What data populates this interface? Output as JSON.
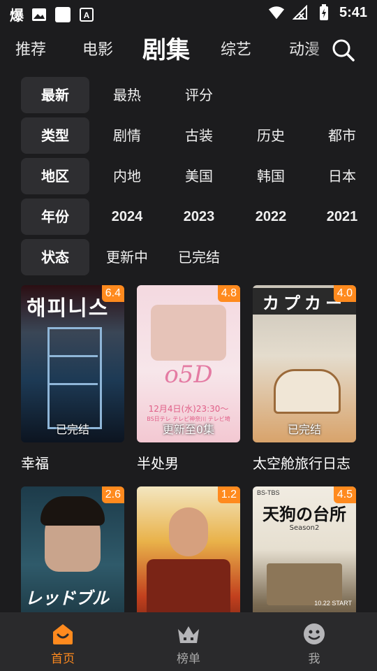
{
  "status_bar": {
    "time": "5:41",
    "left_glyph": "爆"
  },
  "tabs": [
    "推荐",
    "电影",
    "剧集",
    "综艺",
    "动漫"
  ],
  "active_tab": "剧集",
  "filters": [
    {
      "head": "最新",
      "options": [
        "最热",
        "评分"
      ]
    },
    {
      "head": "类型",
      "options": [
        "剧情",
        "古装",
        "历史",
        "都市"
      ]
    },
    {
      "head": "地区",
      "options": [
        "内地",
        "美国",
        "韩国",
        "日本"
      ]
    },
    {
      "head": "年份",
      "options": [
        "2024",
        "2023",
        "2022",
        "2021"
      ]
    },
    {
      "head": "状态",
      "options": [
        "更新中",
        "已完结"
      ]
    }
  ],
  "cards": [
    {
      "title": "幸福",
      "rating": "6.4",
      "status": "已完结",
      "poster_text": "해피니스"
    },
    {
      "title": "半处男",
      "rating": "4.8",
      "status": "更新至0集",
      "poster_text": "o5D",
      "poster_sub": "12月4日(水)23:30～",
      "poster_sub2": "BS日テレ テレビ神奈川 テレビ埼"
    },
    {
      "title": "太空舱旅行日志",
      "rating": "4.0",
      "status": "已完结",
      "poster_text": "カプカー"
    },
    {
      "title": "",
      "rating": "2.6",
      "status": "",
      "poster_text": "レッドブルー"
    },
    {
      "title": "",
      "rating": "1.2",
      "status": "",
      "poster_text": ""
    },
    {
      "title": "",
      "rating": "4.5",
      "status": "",
      "poster_text": "天狗の台所",
      "poster_sub": "Season2",
      "poster_top": "BS-TBS",
      "poster_date": "10.22 START"
    }
  ],
  "bottom_nav": [
    {
      "label": "首页",
      "icon": "home-icon",
      "active": true
    },
    {
      "label": "榜单",
      "icon": "crown-icon",
      "active": false
    },
    {
      "label": "我",
      "icon": "smiley-icon",
      "active": false
    }
  ],
  "colors": {
    "accent": "#ff8a1e",
    "background": "#1c1c1e",
    "chip": "#2e2e31"
  }
}
